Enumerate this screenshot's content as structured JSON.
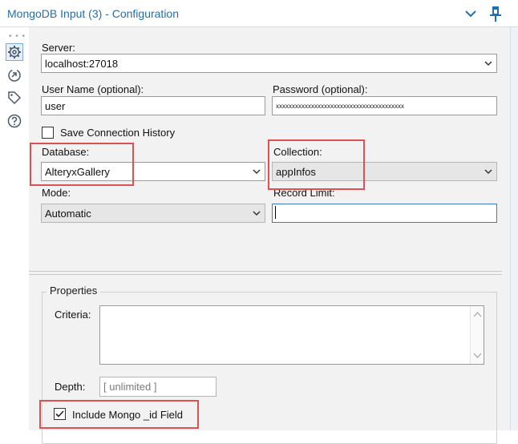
{
  "window": {
    "title": "MongoDB Input (3) - Configuration",
    "collapse_icon": "chevron-down-icon",
    "pin_icon": "pin-icon"
  },
  "toolstrip": {
    "items": [
      "gear-icon",
      "arrow-circle-icon",
      "tag-icon",
      "question-icon"
    ]
  },
  "form": {
    "server_label": "Server:",
    "server_value": "localhost:27018",
    "username_label": "User Name (optional):",
    "username_value": "user",
    "password_label": "Password (optional):",
    "password_value": "xxxxxxxxxxxxxxxxxxxxxxxxxxxxxxxxxxxxxxxx",
    "save_history_label": "Save Connection History",
    "save_history_checked": false,
    "database_label": "Database:",
    "database_value": "AlteryxGallery",
    "collection_label": "Collection:",
    "collection_value": "appInfos",
    "mode_label": "Mode:",
    "mode_value": "Automatic",
    "record_limit_label": "Record Limit:",
    "record_limit_value": ""
  },
  "properties": {
    "group_label": "Properties",
    "criteria_label": "Criteria:",
    "criteria_value": "",
    "depth_label": "Depth:",
    "depth_placeholder": "[ unlimited ]",
    "include_id_label": "Include Mongo _id Field",
    "include_id_checked": true
  },
  "colors": {
    "title": "#1f6fb3",
    "highlight": "#e05050",
    "panel_bg": "#f2f2f2"
  }
}
